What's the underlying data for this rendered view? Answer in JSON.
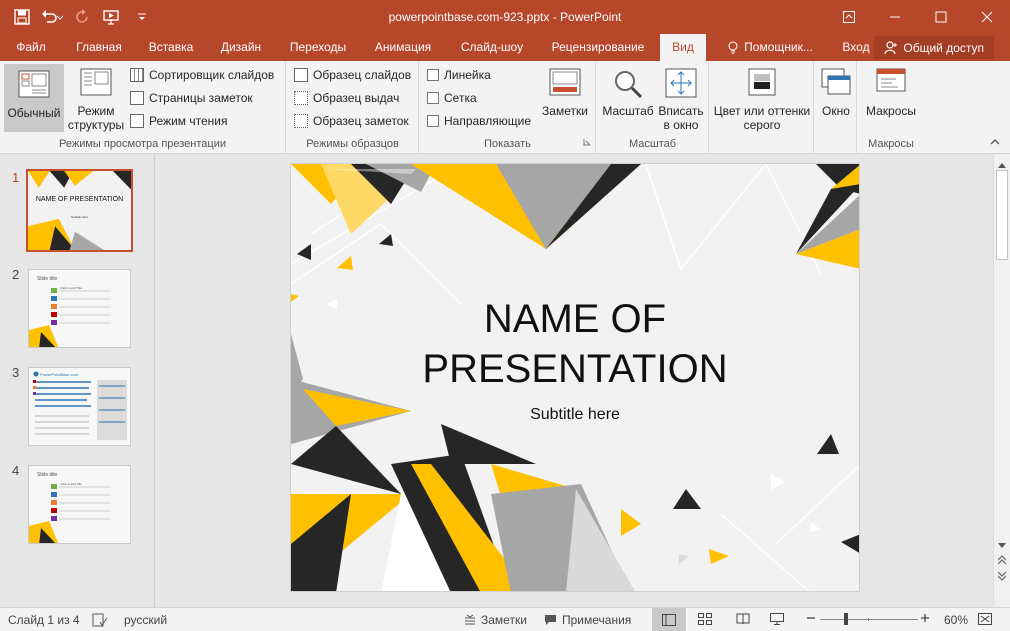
{
  "window": {
    "title": "powerpointbase.com-923.pptx - PowerPoint"
  },
  "tabs": [
    "Файл",
    "Главная",
    "Вставка",
    "Дизайн",
    "Переходы",
    "Анимация",
    "Слайд-шоу",
    "Рецензирование",
    "Вид"
  ],
  "tabs_right": {
    "helper": "Помощник...",
    "login": "Вход",
    "share": "Общий доступ"
  },
  "ribbon": {
    "view_modes": {
      "normal": "Обычный",
      "outline": "Режим структуры",
      "sorter": "Сортировщик слайдов",
      "notes_page": "Страницы заметок",
      "reading": "Режим чтения",
      "group": "Режимы просмотра презентации"
    },
    "masters": {
      "slide_master": "Образец слайдов",
      "handout_master": "Образец выдач",
      "notes_master": "Образец заметок",
      "group": "Режимы образцов"
    },
    "show": {
      "ruler": "Линейка",
      "grid": "Сетка",
      "guides": "Направляющие",
      "notes": "Заметки",
      "group": "Показать"
    },
    "zoom": {
      "zoom": "Масштаб",
      "fit": "Вписать в окно",
      "group": "Масштаб"
    },
    "color": {
      "label": "Цвет или оттенки серого"
    },
    "window": {
      "label": "Окно"
    },
    "macros": {
      "label": "Макросы",
      "group": "Макросы"
    }
  },
  "thumbnails": [
    {
      "num": "1",
      "title": "NAME OF PRESENTATION",
      "subtitle": "Subtitle here"
    },
    {
      "num": "2",
      "title": "Slide title",
      "item": "Click to add Title"
    },
    {
      "num": "3",
      "title": "PowerPointBase.com"
    },
    {
      "num": "4",
      "title": "Slide title",
      "item": "Click to add Title"
    }
  ],
  "slide": {
    "title_line1": "NAME OF",
    "title_line2": "PRESENTATION",
    "subtitle": "Subtitle here"
  },
  "status": {
    "slide": "Слайд 1 из 4",
    "lang": "русский",
    "notes": "Заметки",
    "comments": "Примечания",
    "zoom": "60%"
  },
  "colors": {
    "accent": "#b7472a",
    "yellow": "#ffc000",
    "dark": "#262626",
    "gray": "#a6a6a6"
  }
}
